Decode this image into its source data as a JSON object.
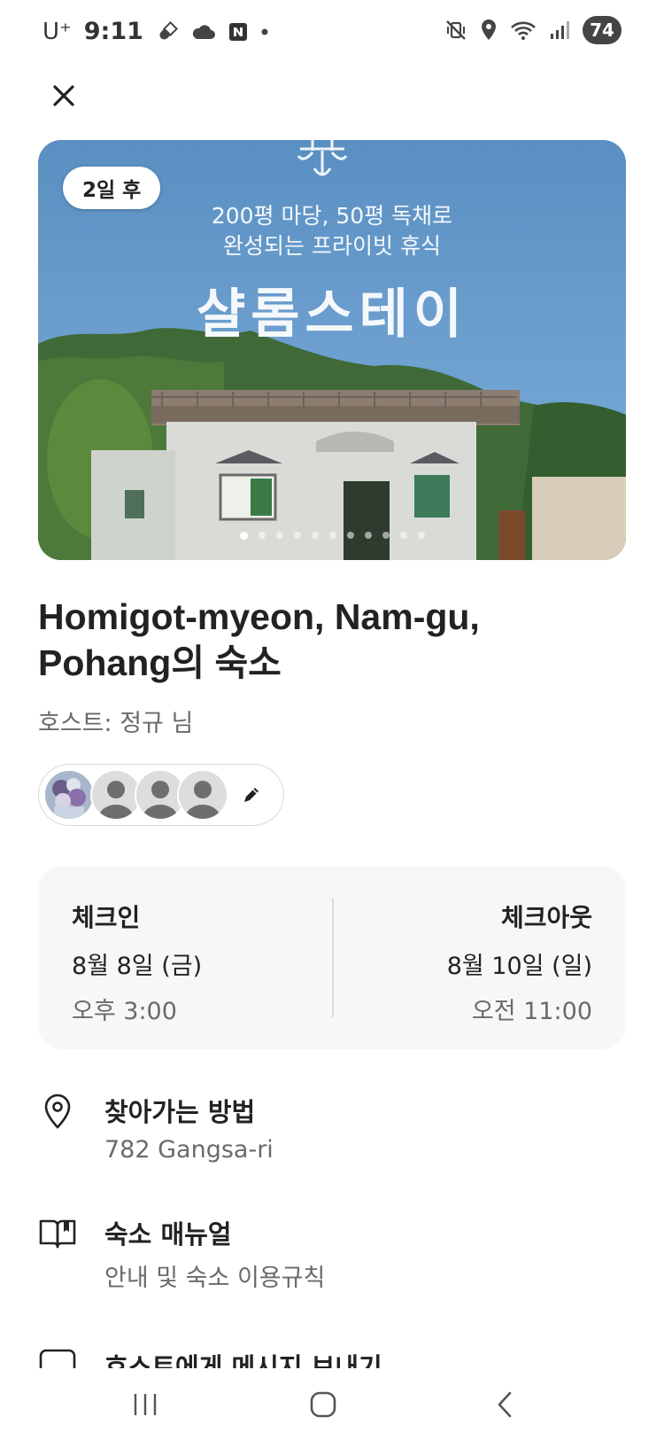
{
  "status_bar": {
    "carrier": "U⁺",
    "time": "9:11",
    "battery": "74",
    "icons": [
      "pill-icon",
      "cloud-icon",
      "naver-icon",
      "dot-icon",
      "mute-vibrate-icon",
      "location-icon",
      "wifi-icon",
      "signal-icon"
    ]
  },
  "header": {
    "close_icon": "close-icon"
  },
  "hero": {
    "badge": "2일 후",
    "overlay_line1": "200평 마당, 50평 독채로",
    "overlay_line2": "완성되는 프라이빗 휴식",
    "overlay_title": "샬롬스테이",
    "photo_count": 11,
    "active_photo": 1
  },
  "listing": {
    "title": "Homigot-myeon, Nam-gu, Pohang의 숙소",
    "host": "호스트: 정규 님"
  },
  "guests": {
    "avatar_count": 4,
    "edit_icon": "pencil-icon"
  },
  "checkin": {
    "label": "체크인",
    "date": "8월 8일 (금)",
    "time": "오후 3:00"
  },
  "checkout": {
    "label": "체크아웃",
    "date": "8월 10일 (일)",
    "time": "오전 11:00"
  },
  "info_rows": [
    {
      "icon": "map-pin-icon",
      "title": "찾아가는 방법",
      "subtitle": "782 Gangsa-ri"
    },
    {
      "icon": "book-icon",
      "title": "숙소 매뉴얼",
      "subtitle": "안내 및 숙소 이용규칙"
    },
    {
      "icon": "message-icon",
      "title": "호스트에게 메시지 보내기"
    }
  ],
  "nav_bar": [
    "recent-apps-icon",
    "home-icon",
    "back-icon"
  ],
  "colors": {
    "text_primary": "#222222",
    "text_secondary": "#6a6a6a",
    "card_bg": "#f7f7f7",
    "sky": "#5f93c4"
  }
}
